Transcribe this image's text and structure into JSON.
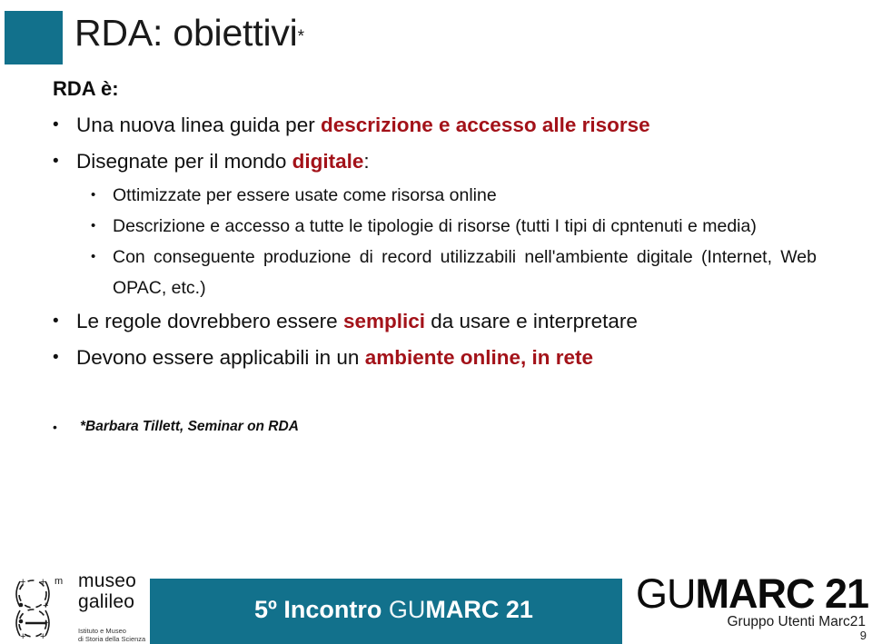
{
  "slide": {
    "title": "RDA: obiettivi",
    "title_marker": "*",
    "subhead": "RDA è:",
    "accent_color": "#12718C",
    "highlight_color": "#A31219"
  },
  "bullets": {
    "b1_pre": "Una nuova linea guida per ",
    "b1_em": "descrizione e accesso alle risorse",
    "b2_pre": "Disegnate per il mondo ",
    "b2_em": "digitale",
    "b2_post": ":",
    "b3": "Ottimizzate per essere usate come risorsa online",
    "b4": "Descrizione e accesso a tutte le tipologie di risorse (tutti I tipi di cpntenuti e media)",
    "b5": "Con conseguente produzione di record utilizzabili nell'ambiente digitale (Internet, Web OPAC, etc.)",
    "b6_pre": "Le regole dovrebbero essere ",
    "b6_em": "semplici",
    "b6_post": " da usare e interpretare",
    "b7_pre": "Devono essere applicabili in un ",
    "b7_em": "ambiente online, in rete",
    "bullet_glyph": "•"
  },
  "footnote": {
    "text": "*Barbara Tillett, Seminar on RDA"
  },
  "footer": {
    "band_part1": "5º Incontro ",
    "band_part2": "GU",
    "band_part3": "MARC 21",
    "logo_line1": "museo",
    "logo_line2": "galileo",
    "logo_sub_line1": "Istituto e Museo",
    "logo_sub_line2": "di Storia della Scienza",
    "logo_mark_superscript": "m",
    "wordmark_light": "GU",
    "wordmark_heavy": "MARC 21",
    "wordmark_sub": "Gruppo Utenti Marc21",
    "page_number": "9"
  }
}
